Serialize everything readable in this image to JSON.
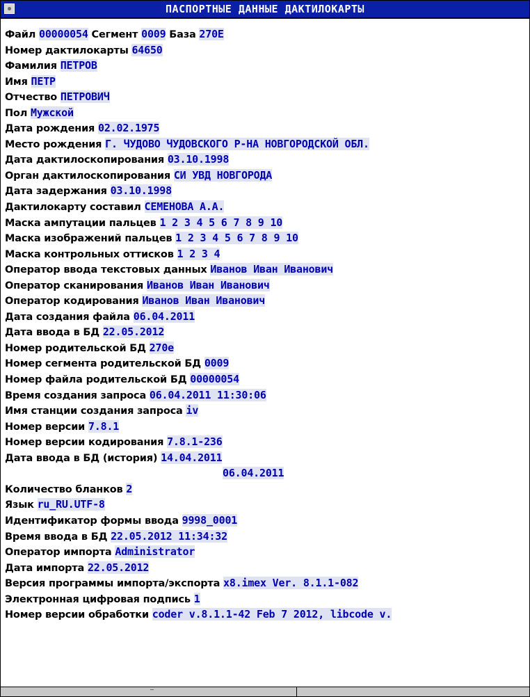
{
  "window": {
    "title": "ПАСПОРТНЫЕ ДАННЫЕ ДАКТИЛОКАРТЫ"
  },
  "rows": [
    [
      [
        "Файл ",
        "l"
      ],
      [
        "00000054",
        "v"
      ],
      [
        " Сегмент ",
        "l"
      ],
      [
        "0009",
        "v"
      ],
      [
        " База ",
        "l"
      ],
      [
        "270E",
        "v"
      ]
    ],
    [
      [
        "Номер дактилокарты ",
        "l"
      ],
      [
        "64650",
        "v"
      ]
    ],
    [
      [
        "Фамилия ",
        "l"
      ],
      [
        "ПЕТРОВ",
        "v"
      ]
    ],
    [
      [
        "Имя ",
        "l"
      ],
      [
        "ПЕТР",
        "v"
      ]
    ],
    [
      [
        "Отчество ",
        "l"
      ],
      [
        "ПЕТРОВИЧ",
        "v"
      ]
    ],
    [
      [
        "Пол ",
        "l"
      ],
      [
        "Мужской",
        "v"
      ]
    ],
    [
      [
        "Дата рождения ",
        "l"
      ],
      [
        "02.02.1975",
        "v"
      ]
    ],
    [
      [
        "Место рождения ",
        "l"
      ],
      [
        "Г. ЧУДОВО ЧУДОВСКОГО Р-НА НОВГОРОДСКОЙ ОБЛ.",
        "v"
      ]
    ],
    [
      [
        "Дата дактилоскопирования ",
        "l"
      ],
      [
        "03.10.1998",
        "v"
      ]
    ],
    [
      [
        "Орган дактилоскопирования ",
        "l"
      ],
      [
        "СИ УВД НОВГОРОДА",
        "v"
      ]
    ],
    [
      [
        "Дата задержания ",
        "l"
      ],
      [
        "03.10.1998",
        "v"
      ]
    ],
    [
      [
        "Дактилокарту составил ",
        "l"
      ],
      [
        "СЕМЕНОВА А.А.",
        "v"
      ]
    ],
    [
      [
        "Маска ампутации пальцев ",
        "l"
      ],
      [
        "1 2 3 4 5 6 7 8 9 10",
        "v"
      ]
    ],
    [
      [
        "Маска изображений пальцев ",
        "l"
      ],
      [
        "1 2 3 4 5 6 7 8 9 10",
        "v"
      ]
    ],
    [
      [
        "Маска контрольных оттисков ",
        "l"
      ],
      [
        "1 2 3 4",
        "v"
      ]
    ],
    [
      [
        "Оператор ввода текстовых данных ",
        "l"
      ],
      [
        "Иванов Иван Иванович",
        "v"
      ]
    ],
    [
      [
        "Оператор сканирования ",
        "l"
      ],
      [
        "Иванов Иван Иванович",
        "v"
      ]
    ],
    [
      [
        "Оператор кодирования ",
        "l"
      ],
      [
        "Иванов Иван Иванович",
        "v"
      ]
    ],
    [
      [
        "Дата создания файла ",
        "l"
      ],
      [
        "06.04.2011",
        "v"
      ]
    ],
    [
      [
        "Дата ввода в БД ",
        "l"
      ],
      [
        "22.05.2012",
        "v"
      ]
    ],
    [
      [
        "Номер родительской БД ",
        "l"
      ],
      [
        "270e",
        "v"
      ]
    ],
    [
      [
        "Номер сегмента родительской БД ",
        "l"
      ],
      [
        "0009",
        "v"
      ]
    ],
    [
      [
        "Номер файла родительской БД ",
        "l"
      ],
      [
        "00000054",
        "v"
      ]
    ],
    [
      [
        "Время создания запроса ",
        "l"
      ],
      [
        "06.04.2011 11:30:06",
        "v"
      ]
    ],
    [
      [
        "Имя станции создания запроса ",
        "l"
      ],
      [
        "iv",
        "v"
      ]
    ],
    [
      [
        "Номер версии ",
        "l"
      ],
      [
        "7.8.1",
        "v"
      ]
    ],
    [
      [
        "Номер версии кодирования ",
        "l"
      ],
      [
        "7.8.1-236",
        "v"
      ]
    ],
    [
      [
        "Дата ввода в БД (история) ",
        "l"
      ],
      [
        "14.04.2011",
        "v"
      ]
    ],
    [
      [
        "",
        "c"
      ],
      [
        "06.04.2011",
        "v"
      ]
    ],
    [
      [
        "Количество бланков ",
        "l"
      ],
      [
        "2",
        "v"
      ]
    ],
    [
      [
        "Язык ",
        "l"
      ],
      [
        "ru_RU.UTF-8",
        "v"
      ]
    ],
    [
      [
        "Идентификатор формы ввода ",
        "l"
      ],
      [
        "9998_0001",
        "v"
      ]
    ],
    [
      [
        "Время ввода в БД ",
        "l"
      ],
      [
        "22.05.2012 11:34:32",
        "v"
      ]
    ],
    [
      [
        "Оператор импорта ",
        "l"
      ],
      [
        "Administrator",
        "v"
      ]
    ],
    [
      [
        "Дата импорта ",
        "l"
      ],
      [
        "22.05.2012",
        "v"
      ]
    ],
    [
      [
        "Версия программы импорта/экспорта ",
        "l"
      ],
      [
        "x8.imex Ver. 8.1.1-082",
        "v"
      ]
    ],
    [
      [
        "Электронная цифровая подпись ",
        "l"
      ],
      [
        "1",
        "v"
      ]
    ],
    [
      [
        "Номер версии обработки ",
        "l"
      ],
      [
        "coder v.8.1.1-42 Feb  7 2012, libcode v.",
        "v"
      ]
    ]
  ]
}
